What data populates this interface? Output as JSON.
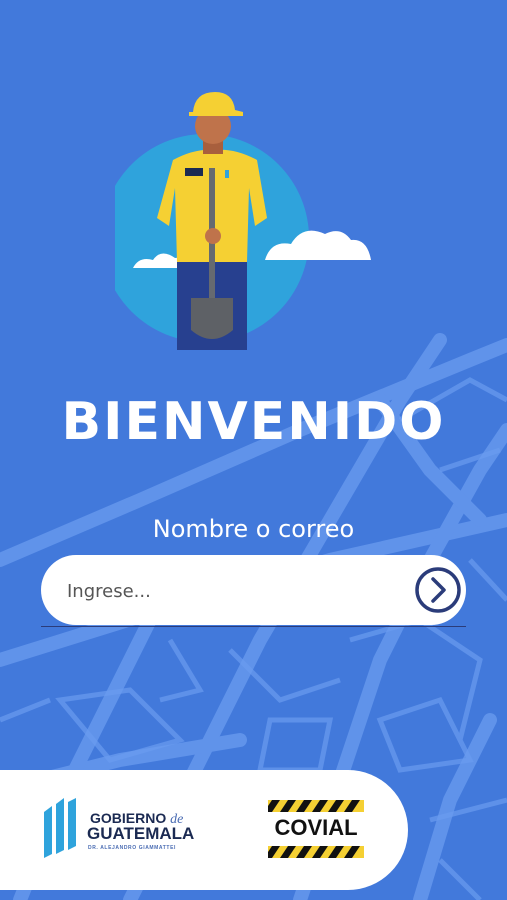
{
  "welcome": {
    "title": "BIENVENIDO"
  },
  "login": {
    "label": "Nombre o correo",
    "placeholder": "Ingrese...",
    "submit_icon": "chevron-right-circle-icon"
  },
  "footer": {
    "gov_line1": "GOBIERNO",
    "gov_de": "de",
    "gov_line2": "GUATEMALA",
    "gov_line3": "DR. ALEJANDRO GIAMMATTEI",
    "covial": "COVIAL"
  },
  "colors": {
    "background": "#4279DB",
    "navy": "#2B3C7A",
    "helmet": "#F5D033",
    "sky": "#2FA3DC"
  }
}
